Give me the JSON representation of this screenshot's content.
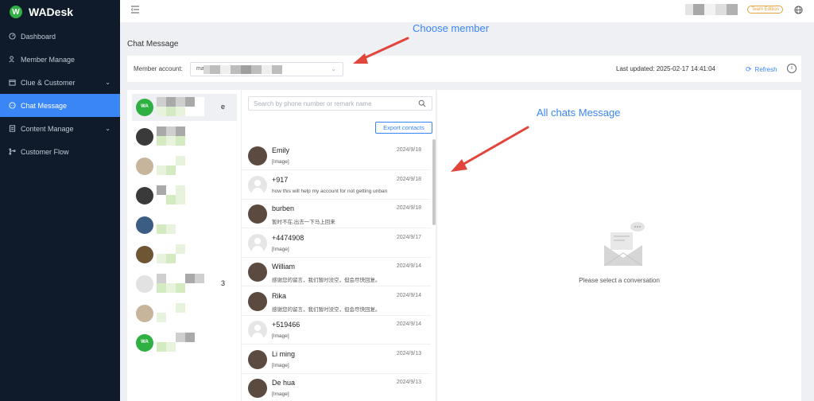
{
  "app": {
    "name": "WADesk",
    "logo_letter": "W"
  },
  "sidebar": {
    "items": [
      {
        "label": "Dashboard",
        "icon": "dashboard-icon",
        "active": false,
        "has_chevron": false
      },
      {
        "label": "Member Manage",
        "icon": "member-icon",
        "active": false,
        "has_chevron": false
      },
      {
        "label": "Clue & Customer",
        "icon": "clue-icon",
        "active": false,
        "has_chevron": true
      },
      {
        "label": "Chat Message",
        "icon": "chat-icon",
        "active": true,
        "has_chevron": false
      },
      {
        "label": "Content Manage",
        "icon": "content-icon",
        "active": false,
        "has_chevron": true
      },
      {
        "label": "Customer Flow",
        "icon": "flow-icon",
        "active": false,
        "has_chevron": false
      }
    ]
  },
  "topbar": {
    "badge": "Team Edition"
  },
  "page": {
    "title": "Chat Message"
  },
  "member_bar": {
    "label": "Member account:",
    "value_prefix": "ma",
    "last_updated": "Last updated: 2025-02-17 14:41:04",
    "refresh_label": "Refresh"
  },
  "members": [
    {
      "avatar": "wa",
      "suffix": "e",
      "active": true
    },
    {
      "avatar": "dark",
      "suffix": "",
      "active": false
    },
    {
      "avatar": "tan",
      "suffix": "",
      "active": false
    },
    {
      "avatar": "dark",
      "suffix": "",
      "active": false
    },
    {
      "avatar": "blue",
      "suffix": "",
      "active": false
    },
    {
      "avatar": "bronze",
      "suffix": "",
      "active": false
    },
    {
      "avatar": "grey",
      "suffix": "3",
      "active": false
    },
    {
      "avatar": "tan",
      "suffix": "",
      "active": false
    },
    {
      "avatar": "wa",
      "suffix": "",
      "active": false
    }
  ],
  "search": {
    "placeholder": "Search by phone number or remark name"
  },
  "export_label": "Export contacts",
  "chats": [
    {
      "name": "Emily",
      "date": "2024/9/18",
      "message": "[Image]",
      "avatar": "person"
    },
    {
      "name": "+917",
      "date": "2024/9/18",
      "message": "how this will help my account for not getting unban",
      "avatar": "light"
    },
    {
      "name": "burben",
      "date": "2024/9/18",
      "message": "暂时不在,出去一下马上回来",
      "avatar": "person"
    },
    {
      "name": "+4474908",
      "date": "2024/9/17",
      "message": "[Image]",
      "avatar": "light"
    },
    {
      "name": "William",
      "date": "2024/9/14",
      "message": "感谢您的留言，我们暂时没空，但会尽快回复。",
      "avatar": "person"
    },
    {
      "name": "Rika",
      "date": "2024/9/14",
      "message": "感谢您的留言，我们暂时没空，但会尽快回复。",
      "avatar": "person"
    },
    {
      "name": "+519466",
      "date": "2024/9/14",
      "message": "[Image]",
      "avatar": "light"
    },
    {
      "name": "Li ming",
      "date": "2024/9/13",
      "message": "[Image]",
      "avatar": "person"
    },
    {
      "name": "De hua",
      "date": "2024/9/13",
      "message": "[Image]",
      "avatar": "person"
    }
  ],
  "empty_state": "Please select a conversation",
  "annotations": {
    "choose_member": "Choose member",
    "all_chats": "All chats Message"
  },
  "colors": {
    "accent": "#3a86f7",
    "sidebar": "#0f1b2b",
    "arrow": "#e2453c",
    "whatsapp": "#2fb043",
    "badge": "#e6a23c"
  }
}
